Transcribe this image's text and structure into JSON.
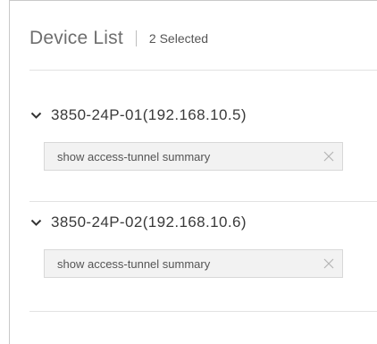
{
  "header": {
    "title": "Device List",
    "selected_label": "2 Selected"
  },
  "devices": [
    {
      "name": "3850-24P-01(192.168.10.5)",
      "expand_icon": "chevron-down-icon",
      "command_tag": "show access-tunnel summary",
      "remove_icon": "close-icon"
    },
    {
      "name": "3850-24P-02(192.168.10.6)",
      "expand_icon": "chevron-down-icon",
      "command_tag": "show access-tunnel summary",
      "remove_icon": "close-icon"
    }
  ],
  "colors": {
    "title": "#6e6e6e",
    "text": "#3a3a3a",
    "tag_bg": "#f2f2f2",
    "divider": "#e2e2e2"
  }
}
